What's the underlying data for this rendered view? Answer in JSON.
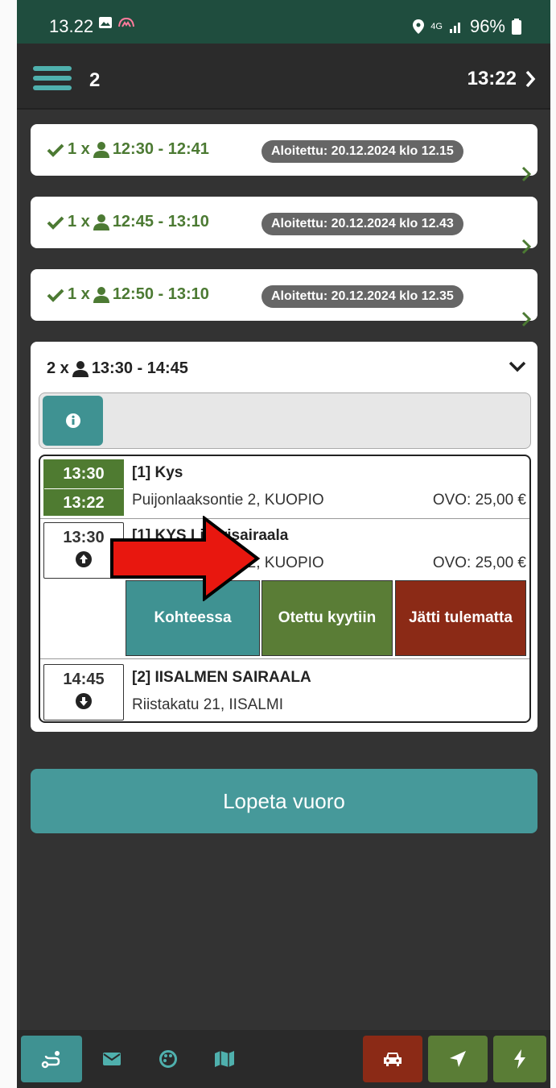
{
  "status": {
    "time": "13.22",
    "network": "4G",
    "battery": "96%"
  },
  "header": {
    "count": "2",
    "time": "13:22"
  },
  "trips": [
    {
      "count": "1 x",
      "range": "12:30 - 12:41",
      "badge": "Aloitettu: 20.12.2024 klo 12.15"
    },
    {
      "count": "1 x",
      "range": "12:45 - 13:10",
      "badge": "Aloitettu: 20.12.2024 klo 12.43"
    },
    {
      "count": "1 x",
      "range": "12:50 - 13:10",
      "badge": "Aloitettu: 20.12.2024 klo 12.35"
    }
  ],
  "active": {
    "count": "2 x",
    "range": "13:30 - 14:45",
    "stops": [
      {
        "time1": "13:30",
        "time2": "13:22",
        "name": "[1] Kys",
        "address": "Puijonlaaksontie 2, KUOPIO",
        "ovo": "OVO: 25,00 €"
      },
      {
        "time1": "13:30",
        "name": "[1] KYS Lisärisairaala",
        "address": "Puijonlaaksontie 2, KUOPIO",
        "ovo": "OVO: 25,00 €"
      },
      {
        "time1": "14:45",
        "name": "[2] IISALMEN SAIRAALA",
        "address": "Riistakatu 21, IISALMI"
      }
    ],
    "actions": {
      "arrived": "Kohteessa",
      "picked_up": "Otettu kyytiin",
      "no_show": "Jätti tulematta"
    }
  },
  "end_shift": "Lopeta vuoro",
  "colors": {
    "green": "#4f7b31",
    "teal": "#46999a",
    "red": "#8b2a16",
    "dark_green": "#1f4d3e"
  },
  "icons": [
    "route-icon",
    "mail-icon",
    "palette-icon",
    "map-icon",
    "car-icon",
    "location-arrow-icon",
    "bolt-icon"
  ]
}
